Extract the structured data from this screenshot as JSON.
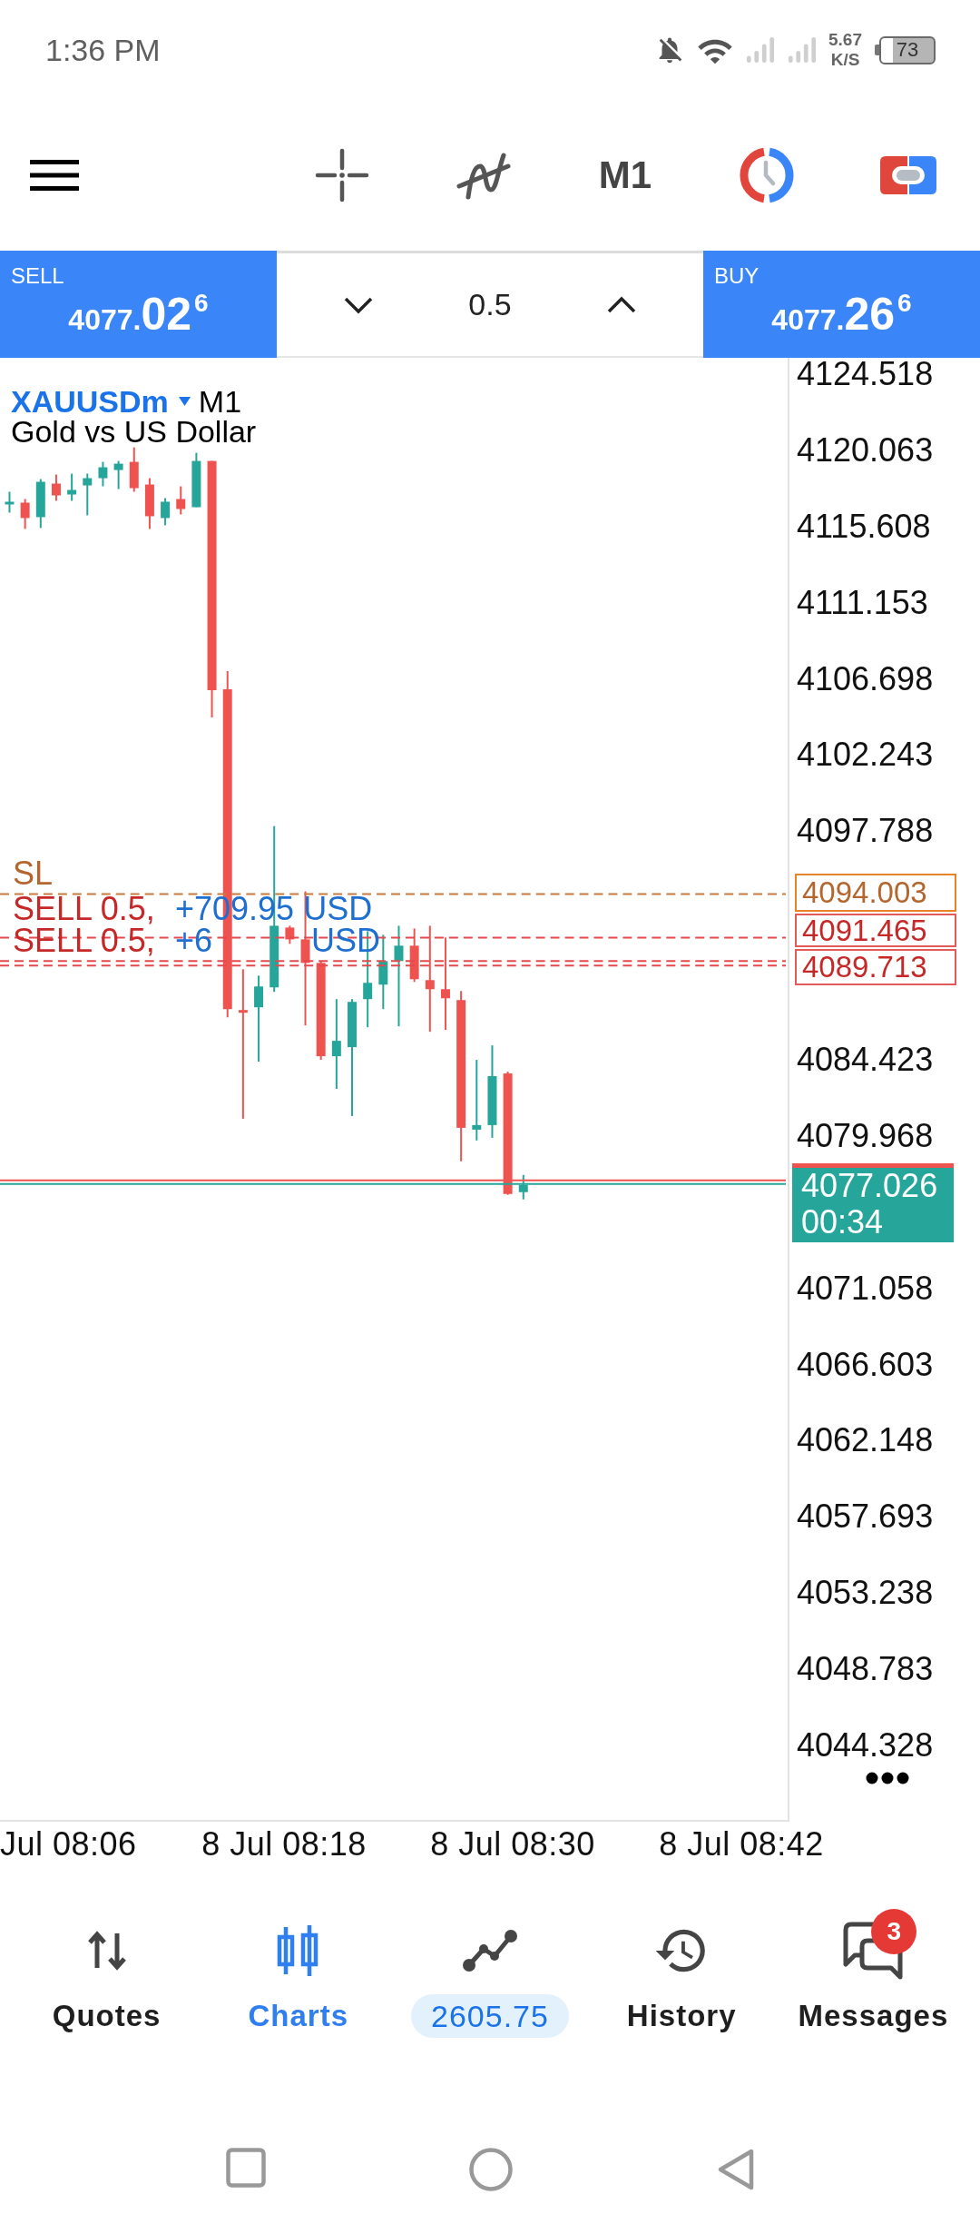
{
  "status_bar": {
    "time": "1:36 PM",
    "network_speed": "5.67",
    "speed_unit": "K/S",
    "battery": "73"
  },
  "toolbar": {
    "timeframe": "M1"
  },
  "trade_panel": {
    "sell": {
      "label": "SELL",
      "price": "4077.**02**$^{6}$"
    },
    "volume": "0.5",
    "buy": {
      "label": "BUY",
      "price": "4077.**26**$^{6}$"
    }
  },
  "chart": {
    "symbol": "XAUUSDm",
    "timeframe": "M1",
    "description": "Gold vs US Dollar",
    "orders": [
      {
        "kind": "stop_loss",
        "label": "SL",
        "price": "4094.003"
      },
      {
        "kind": "order",
        "label": "SELL 0.5,",
        "profit": "+709.95 USD",
        "price": "4091.465"
      },
      {
        "kind": "order",
        "label": "SELL 0.5,",
        "profit": "+6",
        "currency": "USD",
        "price": "4089.713"
      },
      {
        "kind": "order"
      }
    ],
    "price_axis": [
      "4124.518",
      "4120.063",
      "4115.608",
      "4111.153",
      "4106.698",
      "4102.243",
      "4097.788",
      "4084.423",
      "4079.968",
      "4071.058",
      "4066.603",
      "4062.148",
      "4057.693",
      "4053.238",
      "4048.783",
      "4044.328"
    ],
    "current_price": "4077.026",
    "countdown": "00:34",
    "time_axis": [
      "Jul 08:06",
      "8 Jul 08:18",
      "8 Jul 08:30",
      "8 Jul 08:42"
    ]
  },
  "bottom_nav": [
    {
      "kind": "tab",
      "label": "Quotes",
      "selected": false
    },
    {
      "kind": "tab",
      "label": "Charts",
      "selected": true
    },
    {
      "kind": "balance",
      "label": "2605.75",
      "selected": false
    },
    {
      "kind": "tab",
      "label": "History",
      "selected": false
    },
    {
      "kind": "tab",
      "label": "Messages",
      "selected": false,
      "badge": "3"
    }
  ]
}
